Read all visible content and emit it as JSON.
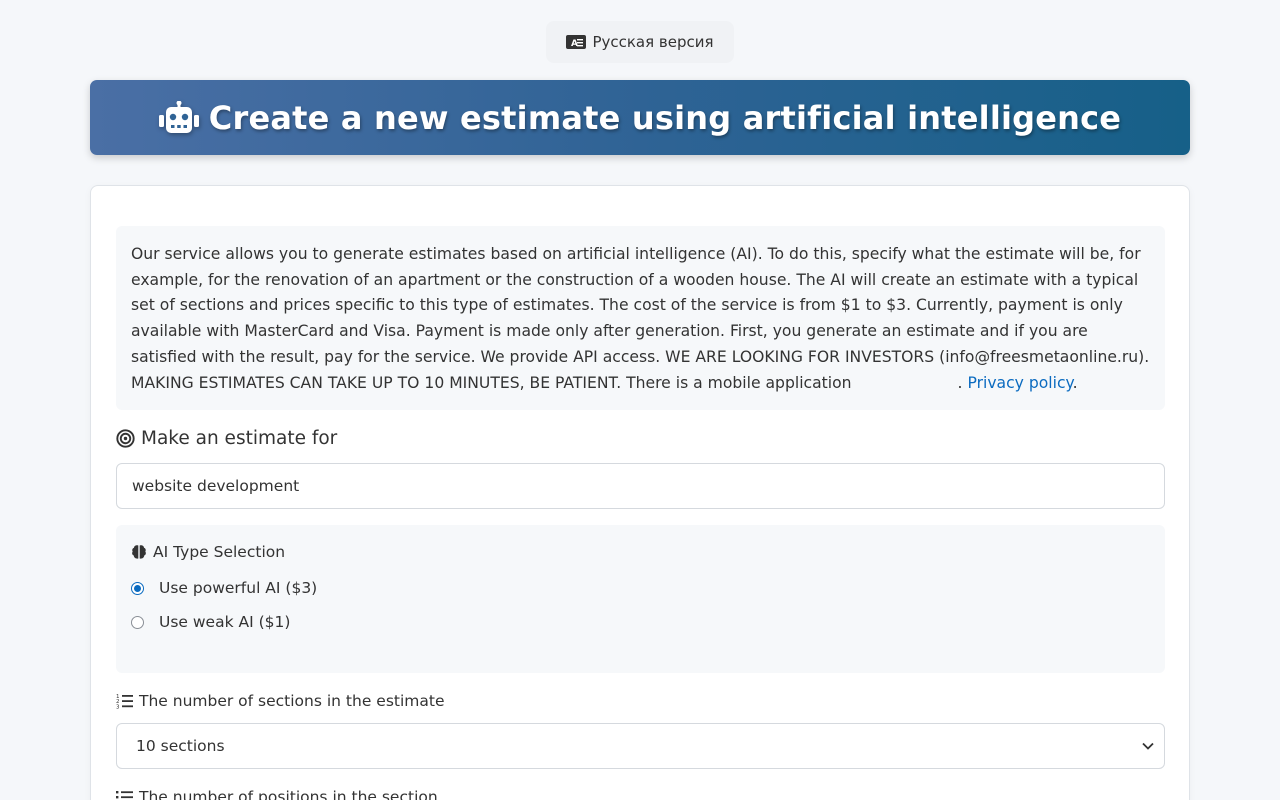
{
  "lang_switch": {
    "label": "Русская версия",
    "icon": "language-icon"
  },
  "header": {
    "title": "Create a new estimate using artificial intelligence",
    "icon": "robot-icon"
  },
  "info": {
    "text": "Our service allows you to generate estimates based on artificial intelligence (AI). To do this, specify what the estimate will be, for example, for the renovation of an apartment or the construction of a wooden house. The AI will create an estimate with a typical set of sections and prices specific to this type of estimates. The cost of the service is from $1 to $3. Currently, payment is only available with MasterCard and Visa. Payment is made only after generation. First, you generate an estimate and if you are satisfied with the result, pay for the service. We provide API access. WE ARE LOOKING FOR INVESTORS (info@freesmetaonline.ru). MAKING ESTIMATES CAN TAKE UP TO 10 MINUTES, BE PATIENT. There is a mobile application",
    "sep": ". ",
    "privacy_link": "Privacy policy",
    "end": "."
  },
  "estimate_for": {
    "label": "Make an estimate for",
    "value": "website development",
    "icon": "target-icon"
  },
  "ai_type": {
    "label": "AI Type Selection",
    "icon": "brain-icon",
    "options": [
      {
        "label": "Use powerful AI ($3)",
        "selected": true
      },
      {
        "label": "Use weak AI ($1)",
        "selected": false
      }
    ]
  },
  "sections": {
    "label": "The number of sections in the estimate",
    "value": "10 sections",
    "icon": "numbered-list-icon"
  },
  "positions": {
    "label": "The number of positions in the section",
    "icon": "list-icon"
  },
  "colors": {
    "accent": "#0b6bc0",
    "header_start": "#4a6fa5",
    "header_end": "#166088"
  }
}
